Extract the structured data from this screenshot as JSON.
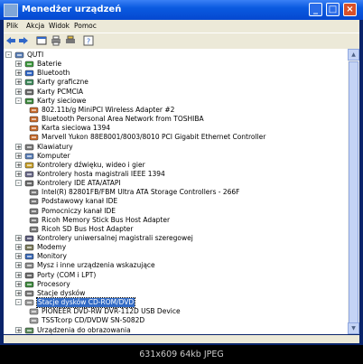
{
  "window": {
    "title": "Menedżer urządzeń",
    "min_label": "_",
    "max_label": "□",
    "close_label": "×"
  },
  "menu": {
    "items": [
      "Plik",
      "Akcja",
      "Widok",
      "Pomoc"
    ]
  },
  "toolbar": {
    "icons": [
      "back-icon",
      "forward-icon",
      "properties-icon",
      "print-icon",
      "print-setup-icon",
      "help-icon"
    ]
  },
  "tree": {
    "rows": [
      {
        "label": "QUTI",
        "icon": "computer-icon",
        "expander": "-",
        "selected": false
      },
      {
        "label": "Baterie",
        "icon": "battery-icon",
        "expander": "+",
        "selected": false
      },
      {
        "label": "Bluetooth",
        "icon": "bluetooth-icon",
        "expander": "+",
        "selected": false
      },
      {
        "label": "Karty graficzne",
        "icon": "display-adapter-icon",
        "expander": "+",
        "selected": false
      },
      {
        "label": "Karty PCMCIA",
        "icon": "pcmcia-icon",
        "expander": "+",
        "selected": false
      },
      {
        "label": "Karty sieciowe",
        "icon": "network-icon",
        "expander": "-",
        "selected": false
      },
      {
        "label": "802.11b/g MiniPCI Wireless Adapter #2",
        "icon": "network-card-icon",
        "expander": "",
        "selected": false
      },
      {
        "label": "Bluetooth Personal Area Network from TOSHIBA",
        "icon": "network-card-icon",
        "expander": "",
        "selected": false
      },
      {
        "label": "Karta sieciowa 1394",
        "icon": "network-card-icon",
        "expander": "",
        "selected": false
      },
      {
        "label": "Marvell Yukon 88E8001/8003/8010 PCI Gigabit Ethernet Controller",
        "icon": "network-card-icon",
        "expander": "",
        "selected": false
      },
      {
        "label": "Klawiatury",
        "icon": "keyboard-icon",
        "expander": "+",
        "selected": false
      },
      {
        "label": "Komputer",
        "icon": "computer-icon",
        "expander": "+",
        "selected": false
      },
      {
        "label": "Kontrolery dźwięku, wideo i gier",
        "icon": "sound-icon",
        "expander": "+",
        "selected": false
      },
      {
        "label": "Kontrolery hosta magistrali IEEE 1394",
        "icon": "controller-icon",
        "expander": "+",
        "selected": false
      },
      {
        "label": "Kontrolery IDE ATA/ATAPI",
        "icon": "ide-icon",
        "expander": "-",
        "selected": false
      },
      {
        "label": "Intel(R) 82801FB/FBM Ultra ATA Storage Controllers - 266F",
        "icon": "ide-controller-icon",
        "expander": "",
        "selected": false
      },
      {
        "label": "Podstawowy kanał IDE",
        "icon": "ide-controller-icon",
        "expander": "",
        "selected": false
      },
      {
        "label": "Pomocniczy kanał IDE",
        "icon": "ide-controller-icon",
        "expander": "",
        "selected": false
      },
      {
        "label": "Ricoh Memory Stick Bus Host Adapter",
        "icon": "ide-controller-icon",
        "expander": "",
        "selected": false
      },
      {
        "label": "Ricoh SD Bus Host Adapter",
        "icon": "ide-controller-icon",
        "expander": "",
        "selected": false
      },
      {
        "label": "Kontrolery uniwersalnej magistrali szeregowej",
        "icon": "usb-icon",
        "expander": "+",
        "selected": false
      },
      {
        "label": "Modemy",
        "icon": "modem-icon",
        "expander": "+",
        "selected": false
      },
      {
        "label": "Monitory",
        "icon": "monitor-icon",
        "expander": "+",
        "selected": false
      },
      {
        "label": "Mysz i inne urządzenia wskazujące",
        "icon": "mouse-icon",
        "expander": "+",
        "selected": false
      },
      {
        "label": "Porty (COM i LPT)",
        "icon": "port-icon",
        "expander": "+",
        "selected": false
      },
      {
        "label": "Procesory",
        "icon": "processor-icon",
        "expander": "+",
        "selected": false
      },
      {
        "label": "Stacje dysków",
        "icon": "disk-drive-icon",
        "expander": "+",
        "selected": false
      },
      {
        "label": "Stacje dysków CD-ROM/DVD",
        "icon": "cdrom-icon",
        "expander": "-",
        "selected": true
      },
      {
        "label": "PIONEER DVD-RW  DVR-112D USB Device",
        "icon": "cdrom-device-icon",
        "expander": "",
        "selected": false
      },
      {
        "label": "TSSTcorp CD/DVDW SN-S082D",
        "icon": "cdrom-device-icon",
        "expander": "",
        "selected": false
      },
      {
        "label": "Urządzenia do obrazowania",
        "icon": "imaging-icon",
        "expander": "+",
        "selected": false
      }
    ]
  },
  "caption": "631x609 64kb JPEG"
}
